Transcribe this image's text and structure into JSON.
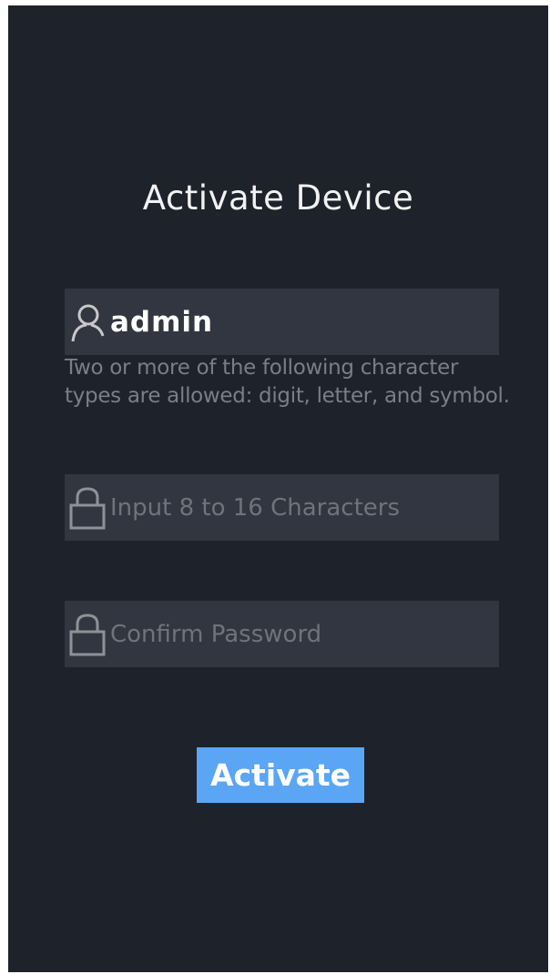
{
  "header": {
    "title": "Activate Device"
  },
  "form": {
    "username": {
      "value": "admin",
      "icon": "user-icon"
    },
    "hint": "Two or more of the following character types are allowed: digit, letter, and symbol.",
    "password": {
      "placeholder": "Input 8 to 16 Characters",
      "icon": "lock-icon"
    },
    "confirm": {
      "placeholder": "Confirm Password",
      "icon": "lock-icon"
    },
    "submit_label": "Activate"
  },
  "colors": {
    "background": "#1e222a",
    "field": "#323640",
    "accent": "#5aa6f5",
    "placeholder": "#6f737b"
  }
}
